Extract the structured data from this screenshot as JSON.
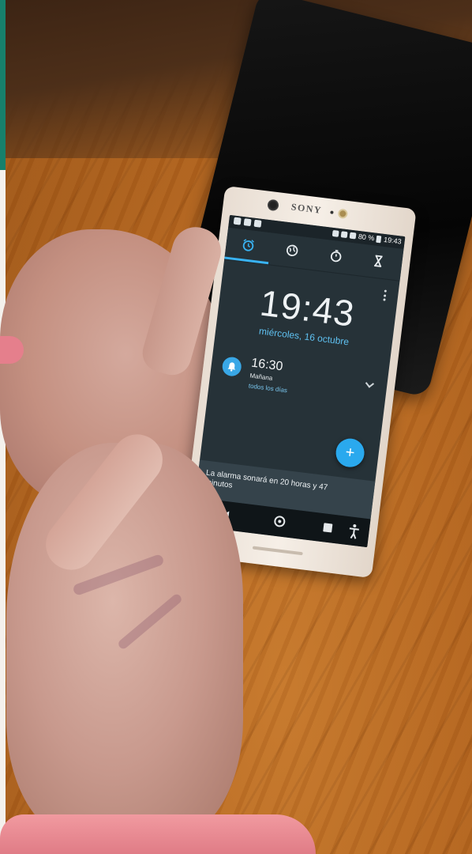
{
  "phone": {
    "brand": "SONY",
    "status_bar": {
      "battery": "80 %",
      "time": "19:43"
    },
    "tabs": [
      {
        "icon": "alarm-clock-icon",
        "active": true
      },
      {
        "icon": "world-clock-icon",
        "active": false
      },
      {
        "icon": "stopwatch-icon",
        "active": false
      },
      {
        "icon": "hourglass-timer-icon",
        "active": false
      }
    ],
    "clock": {
      "time": "19:43",
      "date": "miércoles, 16 octubre"
    },
    "alarm": {
      "time": "16:30",
      "label": "Mañana",
      "repeat": "todos los días",
      "enabled": true
    },
    "fab_label": "+",
    "snackbar": "La alarma sonará en 20 horas y 47 minutos",
    "colors": {
      "accent": "#39b3f3",
      "screen_bg": "#263238",
      "snackbar_bg": "#35434b"
    }
  }
}
